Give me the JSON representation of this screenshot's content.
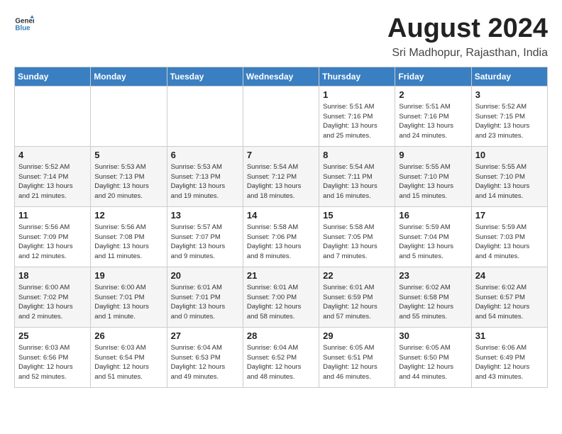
{
  "header": {
    "logo_general": "General",
    "logo_blue": "Blue",
    "title": "August 2024",
    "subtitle": "Sri Madhopur, Rajasthan, India"
  },
  "days_of_week": [
    "Sunday",
    "Monday",
    "Tuesday",
    "Wednesday",
    "Thursday",
    "Friday",
    "Saturday"
  ],
  "weeks": [
    [
      {
        "day": "",
        "info": ""
      },
      {
        "day": "",
        "info": ""
      },
      {
        "day": "",
        "info": ""
      },
      {
        "day": "",
        "info": ""
      },
      {
        "day": "1",
        "info": "Sunrise: 5:51 AM\nSunset: 7:16 PM\nDaylight: 13 hours\nand 25 minutes."
      },
      {
        "day": "2",
        "info": "Sunrise: 5:51 AM\nSunset: 7:16 PM\nDaylight: 13 hours\nand 24 minutes."
      },
      {
        "day": "3",
        "info": "Sunrise: 5:52 AM\nSunset: 7:15 PM\nDaylight: 13 hours\nand 23 minutes."
      }
    ],
    [
      {
        "day": "4",
        "info": "Sunrise: 5:52 AM\nSunset: 7:14 PM\nDaylight: 13 hours\nand 21 minutes."
      },
      {
        "day": "5",
        "info": "Sunrise: 5:53 AM\nSunset: 7:13 PM\nDaylight: 13 hours\nand 20 minutes."
      },
      {
        "day": "6",
        "info": "Sunrise: 5:53 AM\nSunset: 7:13 PM\nDaylight: 13 hours\nand 19 minutes."
      },
      {
        "day": "7",
        "info": "Sunrise: 5:54 AM\nSunset: 7:12 PM\nDaylight: 13 hours\nand 18 minutes."
      },
      {
        "day": "8",
        "info": "Sunrise: 5:54 AM\nSunset: 7:11 PM\nDaylight: 13 hours\nand 16 minutes."
      },
      {
        "day": "9",
        "info": "Sunrise: 5:55 AM\nSunset: 7:10 PM\nDaylight: 13 hours\nand 15 minutes."
      },
      {
        "day": "10",
        "info": "Sunrise: 5:55 AM\nSunset: 7:10 PM\nDaylight: 13 hours\nand 14 minutes."
      }
    ],
    [
      {
        "day": "11",
        "info": "Sunrise: 5:56 AM\nSunset: 7:09 PM\nDaylight: 13 hours\nand 12 minutes."
      },
      {
        "day": "12",
        "info": "Sunrise: 5:56 AM\nSunset: 7:08 PM\nDaylight: 13 hours\nand 11 minutes."
      },
      {
        "day": "13",
        "info": "Sunrise: 5:57 AM\nSunset: 7:07 PM\nDaylight: 13 hours\nand 9 minutes."
      },
      {
        "day": "14",
        "info": "Sunrise: 5:58 AM\nSunset: 7:06 PM\nDaylight: 13 hours\nand 8 minutes."
      },
      {
        "day": "15",
        "info": "Sunrise: 5:58 AM\nSunset: 7:05 PM\nDaylight: 13 hours\nand 7 minutes."
      },
      {
        "day": "16",
        "info": "Sunrise: 5:59 AM\nSunset: 7:04 PM\nDaylight: 13 hours\nand 5 minutes."
      },
      {
        "day": "17",
        "info": "Sunrise: 5:59 AM\nSunset: 7:03 PM\nDaylight: 13 hours\nand 4 minutes."
      }
    ],
    [
      {
        "day": "18",
        "info": "Sunrise: 6:00 AM\nSunset: 7:02 PM\nDaylight: 13 hours\nand 2 minutes."
      },
      {
        "day": "19",
        "info": "Sunrise: 6:00 AM\nSunset: 7:01 PM\nDaylight: 13 hours\nand 1 minute."
      },
      {
        "day": "20",
        "info": "Sunrise: 6:01 AM\nSunset: 7:01 PM\nDaylight: 13 hours\nand 0 minutes."
      },
      {
        "day": "21",
        "info": "Sunrise: 6:01 AM\nSunset: 7:00 PM\nDaylight: 12 hours\nand 58 minutes."
      },
      {
        "day": "22",
        "info": "Sunrise: 6:01 AM\nSunset: 6:59 PM\nDaylight: 12 hours\nand 57 minutes."
      },
      {
        "day": "23",
        "info": "Sunrise: 6:02 AM\nSunset: 6:58 PM\nDaylight: 12 hours\nand 55 minutes."
      },
      {
        "day": "24",
        "info": "Sunrise: 6:02 AM\nSunset: 6:57 PM\nDaylight: 12 hours\nand 54 minutes."
      }
    ],
    [
      {
        "day": "25",
        "info": "Sunrise: 6:03 AM\nSunset: 6:56 PM\nDaylight: 12 hours\nand 52 minutes."
      },
      {
        "day": "26",
        "info": "Sunrise: 6:03 AM\nSunset: 6:54 PM\nDaylight: 12 hours\nand 51 minutes."
      },
      {
        "day": "27",
        "info": "Sunrise: 6:04 AM\nSunset: 6:53 PM\nDaylight: 12 hours\nand 49 minutes."
      },
      {
        "day": "28",
        "info": "Sunrise: 6:04 AM\nSunset: 6:52 PM\nDaylight: 12 hours\nand 48 minutes."
      },
      {
        "day": "29",
        "info": "Sunrise: 6:05 AM\nSunset: 6:51 PM\nDaylight: 12 hours\nand 46 minutes."
      },
      {
        "day": "30",
        "info": "Sunrise: 6:05 AM\nSunset: 6:50 PM\nDaylight: 12 hours\nand 44 minutes."
      },
      {
        "day": "31",
        "info": "Sunrise: 6:06 AM\nSunset: 6:49 PM\nDaylight: 12 hours\nand 43 minutes."
      }
    ]
  ]
}
